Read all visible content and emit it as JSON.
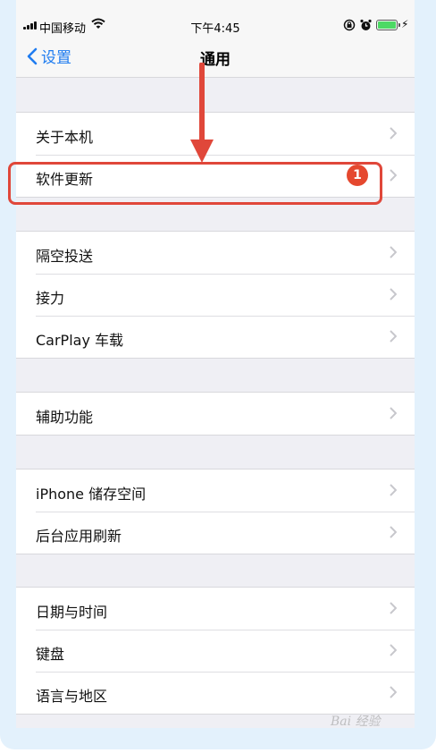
{
  "status_bar": {
    "carrier": "中国移动",
    "time": "下午4:45"
  },
  "nav": {
    "back_label": "设置",
    "title": "通用"
  },
  "groups": [
    [
      {
        "label": "关于本机"
      },
      {
        "label": "软件更新",
        "badge": "1"
      }
    ],
    [
      {
        "label": "隔空投送"
      },
      {
        "label": "接力"
      },
      {
        "label": "CarPlay 车载"
      }
    ],
    [
      {
        "label": "辅助功能"
      }
    ],
    [
      {
        "label": "iPhone 储存空间"
      },
      {
        "label": "后台应用刷新"
      }
    ],
    [
      {
        "label": "日期与时间"
      },
      {
        "label": "键盘"
      },
      {
        "label": "语言与地区"
      }
    ]
  ],
  "watermark": "Bai 经验",
  "colors": {
    "accent": "#1f7cf0",
    "badge": "#e5482f",
    "annotation": "#e0473a",
    "battery": "#4cd964"
  },
  "icons": [
    "signal-icon",
    "wifi-icon",
    "orientation-lock-icon",
    "alarm-icon",
    "battery-icon",
    "charging-icon",
    "back-chevron-icon",
    "chevron-right-icon"
  ]
}
